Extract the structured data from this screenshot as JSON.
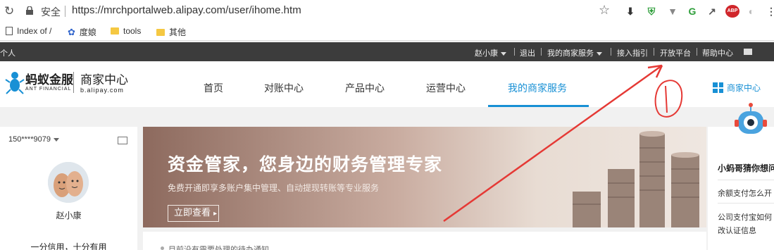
{
  "browser": {
    "secure_label": "安全",
    "url": "https://mrchportalweb.alipay.com/user/ihome.htm",
    "bookmarks": [
      {
        "label": "Index of /"
      },
      {
        "label": "度娘"
      },
      {
        "label": "tools"
      },
      {
        "label": "其他"
      }
    ]
  },
  "topbar": {
    "left_label": "个人",
    "user": "赵小康",
    "logout": "退出",
    "my_services": "我的商家服务",
    "guide": "接入指引",
    "open_platform": "开放平台",
    "help": "帮助中心"
  },
  "header": {
    "logo_cn": "蚂蚁金服",
    "logo_en": "ANT FINANCIAL",
    "site_cn": "商家中心",
    "site_en": "b.alipay.com",
    "nav": [
      "首页",
      "对账中心",
      "产品中心",
      "运营中心",
      "我的商家服务"
    ],
    "active_nav": "我的商家服务",
    "merchant_center": "商家中心"
  },
  "sidebar": {
    "account": "150****9079",
    "username": "赵小康",
    "motto": "一分信用，十分有用"
  },
  "banner": {
    "title": "资金管家，您身边的财务管理专家",
    "subtitle": "免费开通即享多账户集中管理、自动提现转账等专业服务",
    "button": "立即查看"
  },
  "notice": {
    "text": "目前没有需要处理的待办通知"
  },
  "assistant": {
    "title": "小蚂哥猜你想问",
    "questions": [
      "余额支付怎么开",
      "公司支付宝如何",
      "改认证信息"
    ]
  },
  "colors": {
    "accent": "#1890d5",
    "topbar": "#3c3c3c",
    "annotation": "#e53935"
  }
}
